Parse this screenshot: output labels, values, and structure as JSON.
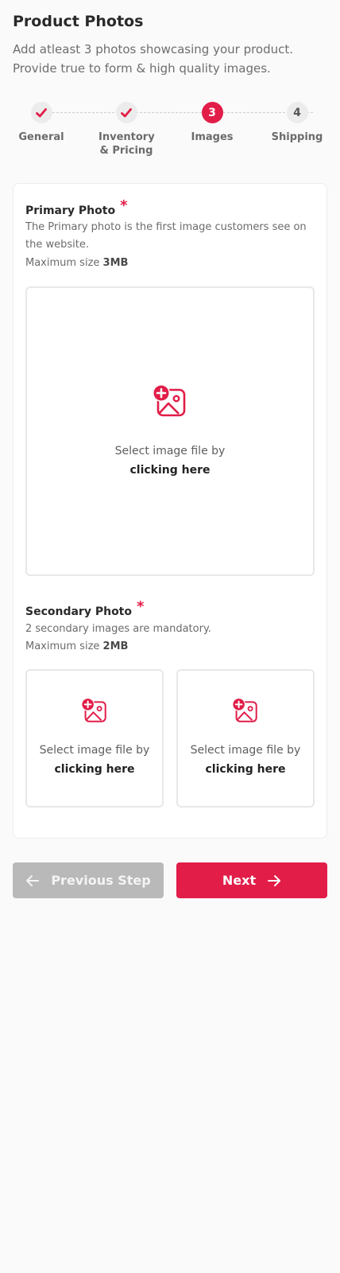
{
  "header": {
    "title": "Product Photos",
    "subtitle": "Add atleast 3 photos showcasing your product. Provide true to form & high quality images."
  },
  "stepper": {
    "steps": [
      {
        "label": "General",
        "status": "done",
        "marker": ""
      },
      {
        "label": "Inventory & Pricing",
        "status": "done",
        "marker": ""
      },
      {
        "label": "Images",
        "status": "active",
        "marker": "3"
      },
      {
        "label": "Shipping",
        "status": "pending",
        "marker": "4"
      }
    ]
  },
  "primary": {
    "title": "Primary Photo",
    "required_mark": "*",
    "description": "The Primary photo is the first image customers see on the website.",
    "max_size_label": "Maximum size",
    "max_size_value": "3MB",
    "upload_text": "Select image file by",
    "upload_cta": "clicking here",
    "icon": "image-add-icon"
  },
  "secondary": {
    "title": "Secondary Photo",
    "required_mark": "*",
    "description": "2 secondary images are mandatory.",
    "max_size_label": "Maximum size",
    "max_size_value": "2MB",
    "slots": [
      {
        "upload_text": "Select image file by",
        "upload_cta": "clicking here",
        "icon": "image-add-icon"
      },
      {
        "upload_text": "Select image file by",
        "upload_cta": "clicking here",
        "icon": "image-add-icon"
      }
    ]
  },
  "actions": {
    "prev_label": "Previous Step",
    "prev_icon": "arrow-left-icon",
    "next_label": "Next",
    "next_icon": "arrow-right-icon"
  },
  "colors": {
    "accent": "#e11d48",
    "disabled_button": "#b9b9b9",
    "background": "#fafafa"
  }
}
